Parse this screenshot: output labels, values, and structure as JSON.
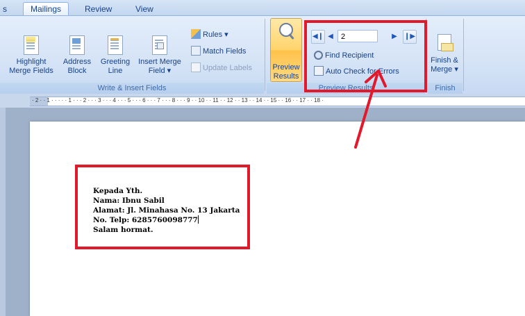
{
  "tabs": {
    "partial": "s",
    "mailings": "Mailings",
    "review": "Review",
    "view": "View"
  },
  "write_insert": {
    "highlight": [
      "Highlight",
      "Merge Fields"
    ],
    "address": [
      "Address",
      "Block"
    ],
    "greeting": [
      "Greeting",
      "Line"
    ],
    "insert_merge": [
      "Insert Merge",
      "Field ▾"
    ],
    "rules": "Rules ▾",
    "match_fields": "Match Fields",
    "update_labels": "Update Labels",
    "group_label": "Write & Insert Fields"
  },
  "preview": {
    "preview_results": [
      "Preview",
      "Results"
    ],
    "record_number": "2",
    "find_recipient": "Find Recipient",
    "auto_check": "Auto Check for Errors",
    "group_label": "Preview Results"
  },
  "finish": {
    "finish_merge": [
      "Finish &",
      "Merge ▾"
    ],
    "group_label": "Finish"
  },
  "ruler": {
    "ticks": "· 2 · · 1 · · · · · 1 · · · 2 · · · 3 · · · 4 · · · 5 · · · 6 · · · 7 · · · 8 · · · 9 · · 10 · · 11 · · 12 · · 13 · · 14 · · 15 · · 16 · · 17 · · 18 ·"
  },
  "letter": {
    "line1": "Kepada Yth.",
    "line2": "Nama: Ibnu Sabil",
    "line3": "Alamat: Jl. Minahasa No. 13 Jakarta",
    "line4": "No. Telp: 6285760098777",
    "line5": "Salam hormat."
  },
  "annotation_color": "#e2182b",
  "icons": [
    "highlight-merge-fields-icon",
    "address-block-icon",
    "greeting-line-icon",
    "insert-merge-field-icon",
    "rules-icon",
    "match-fields-icon",
    "update-labels-icon",
    "preview-results-icon",
    "first-record-icon",
    "previous-record-icon",
    "next-record-icon",
    "last-record-icon",
    "find-recipient-icon",
    "auto-check-icon",
    "finish-merge-icon"
  ]
}
